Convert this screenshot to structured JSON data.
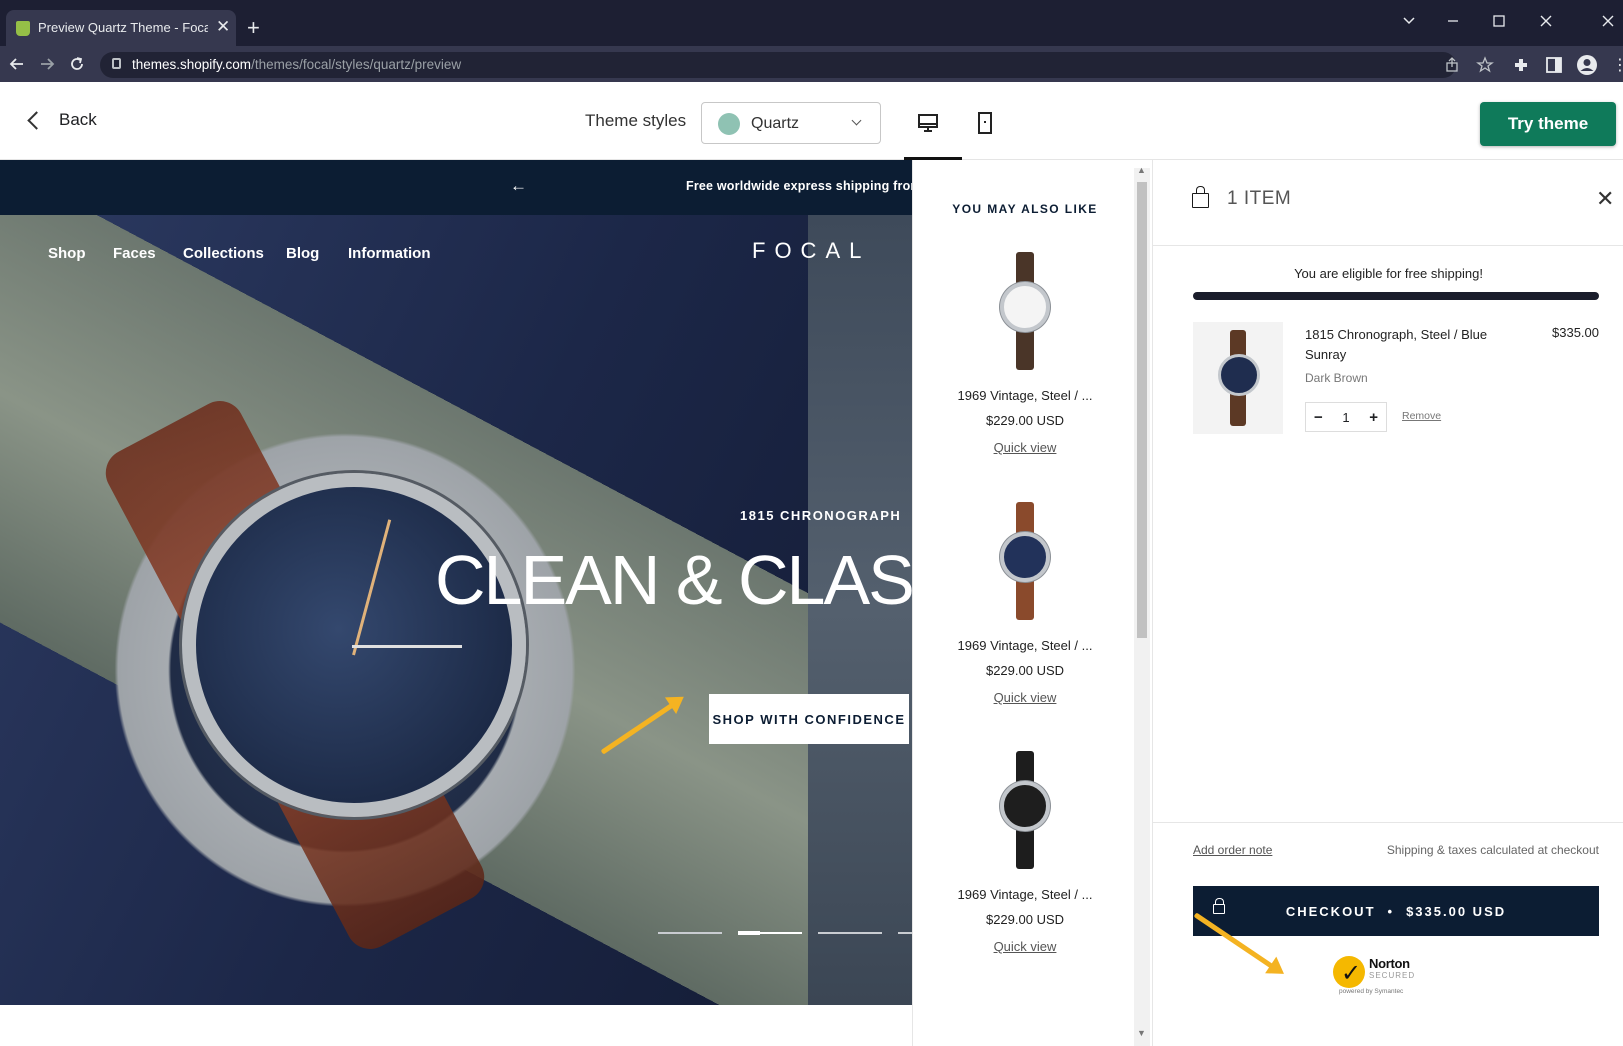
{
  "browser": {
    "tab_title": "Preview Quartz Theme - Focal Ec",
    "tab_close": "✕",
    "new_tab": "+",
    "url_host": "themes.shopify.com",
    "url_path": "/themes/focal/styles/quartz/preview",
    "icons": [
      "back-arrow-icon",
      "forward-arrow-icon",
      "reload-icon",
      "lock-icon",
      "share-icon",
      "star-icon",
      "extensions-icon",
      "sidepanel-icon",
      "profile-icon"
    ]
  },
  "theme_bar": {
    "back_label": "Back",
    "theme_styles_label": "Theme styles",
    "selected_style": "Quartz",
    "style_swatch_color": "#8fc2b3",
    "try_theme_label": "Try theme",
    "try_theme_color": "#0f7a5a"
  },
  "store": {
    "announcement": "Free worldwide express shipping from $",
    "nav": [
      "Shop",
      "Faces",
      "Collections",
      "Blog",
      "Information"
    ],
    "logo": "FOCAL",
    "hero_kicker": "1815 CHRONOGRAPH",
    "hero_title": "CLEAN & CLASSIC",
    "hero_button": "SHOP WITH CONFIDENCE",
    "slides_count": 4,
    "active_slide": 2,
    "brand_navy": "#0c1d33"
  },
  "recommendations": {
    "title": "YOU MAY ALSO LIKE",
    "items": [
      {
        "name": "1969 Vintage, Steel / ...",
        "price": "$229.00 USD",
        "link": "Quick view",
        "strap_color": "#4a3528",
        "dial_color": "#f4f4f4"
      },
      {
        "name": "1969 Vintage, Steel / ...",
        "price": "$229.00 USD",
        "link": "Quick view",
        "strap_color": "#8a4a2c",
        "dial_color": "#22325a"
      },
      {
        "name": "1969 Vintage, Steel / ...",
        "price": "$229.00 USD",
        "link": "Quick view",
        "strap_color": "#1d1d1d",
        "dial_color": "#1e1e1e"
      }
    ]
  },
  "cart": {
    "count_label": "1 ITEM",
    "free_shipping_msg": "You are eligible for free shipping!",
    "free_shipping_progress": 1.0,
    "line_items": [
      {
        "title": "1815 Chronograph, Steel / Blue Sunray",
        "price": "$335.00",
        "variant": "Dark Brown",
        "qty": "1",
        "remove": "Remove"
      }
    ],
    "order_note": "Add order note",
    "taxes_note": "Shipping & taxes calculated at checkout",
    "checkout_label": "CHECKOUT",
    "checkout_sep": "•",
    "checkout_total": "$335.00 USD",
    "norton": {
      "name": "Norton",
      "secured": "SECURED",
      "powered": "powered by Symantec"
    }
  }
}
